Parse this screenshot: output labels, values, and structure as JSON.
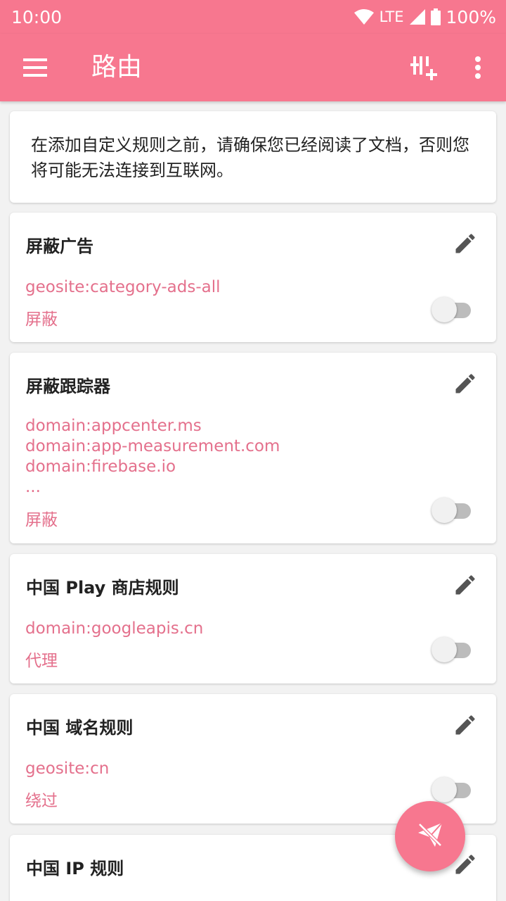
{
  "status_bar": {
    "time": "10:00",
    "network": "LTE",
    "battery": "100%"
  },
  "app_bar": {
    "title": "路由",
    "menu_icon": "hamburger-menu-icon",
    "add_icon": "add-rule-icon",
    "more_icon": "more-vert-icon"
  },
  "notice": {
    "text": "在添加自定义规则之前，请确保您已经阅读了文档，否则您将可能无法连接到互联网。"
  },
  "rules": [
    {
      "title": "屏蔽广告",
      "lines": [
        "geosite:category-ads-all"
      ],
      "action": "屏蔽",
      "enabled": false
    },
    {
      "title": "屏蔽跟踪器",
      "lines": [
        "domain:appcenter.ms",
        "domain:app-measurement.com",
        "domain:firebase.io",
        "..."
      ],
      "action": "屏蔽",
      "enabled": false
    },
    {
      "title": "中国 Play 商店规则",
      "lines": [
        "domain:googleapis.cn"
      ],
      "action": "代理",
      "enabled": false
    },
    {
      "title": "中国 域名规则",
      "lines": [
        "geosite:cn"
      ],
      "action": "绕过",
      "enabled": false
    },
    {
      "title": "中国 IP 规则",
      "lines": [],
      "action": "",
      "enabled": false
    }
  ],
  "fab": {
    "icon": "paper-plane-off-icon"
  },
  "colors": {
    "primary": "#f7778f",
    "accent_text": "#e4708c",
    "background": "#f2f2f2"
  }
}
